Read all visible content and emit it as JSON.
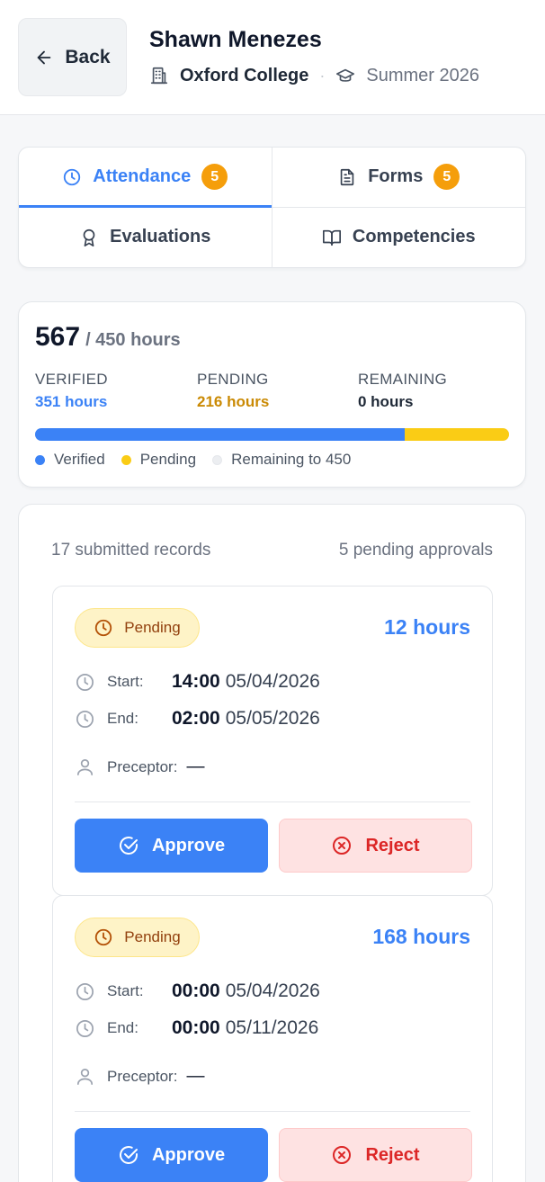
{
  "header": {
    "back_label": "Back",
    "student_name": "Shawn Menezes",
    "college": "Oxford College",
    "separator": "·",
    "term": "Summer 2026"
  },
  "tabs": [
    {
      "label": "Attendance",
      "badge": "5",
      "active": true,
      "icon": "clock-icon"
    },
    {
      "label": "Forms",
      "badge": "5",
      "active": false,
      "icon": "document-icon"
    },
    {
      "label": "Evaluations",
      "badge": null,
      "active": false,
      "icon": "award-icon"
    },
    {
      "label": "Competencies",
      "badge": null,
      "active": false,
      "icon": "book-icon"
    }
  ],
  "summary": {
    "total": "567",
    "of_total": "/ 450 hours",
    "verified_label": "VERIFIED",
    "verified_value": "351 hours",
    "pending_label": "PENDING",
    "pending_value": "216 hours",
    "remaining_label": "REMAINING",
    "remaining_value": "0 hours",
    "verified_fraction": 0.78,
    "pending_fraction": 0.22,
    "legend_verified": "Verified",
    "legend_pending": "Pending",
    "legend_remaining": "Remaining to 450"
  },
  "records_header": {
    "submitted": "17 submitted records",
    "pending": "5 pending approvals"
  },
  "labels": {
    "start": "Start:",
    "end": "End:",
    "preceptor": "Preceptor:",
    "approve": "Approve",
    "reject": "Reject"
  },
  "records": [
    {
      "status": "Pending",
      "hours": "12 hours",
      "start_time": "14:00",
      "start_date": "05/04/2026",
      "end_time": "02:00",
      "end_date": "05/05/2026",
      "preceptor": "—"
    },
    {
      "status": "Pending",
      "hours": "168 hours",
      "start_time": "00:00",
      "start_date": "05/04/2026",
      "end_time": "00:00",
      "end_date": "05/11/2026",
      "preceptor": "—"
    }
  ],
  "colors": {
    "accent": "#3b82f6",
    "pending": "#facc15",
    "badge": "#f59e0b",
    "reject": "#dc2626"
  }
}
